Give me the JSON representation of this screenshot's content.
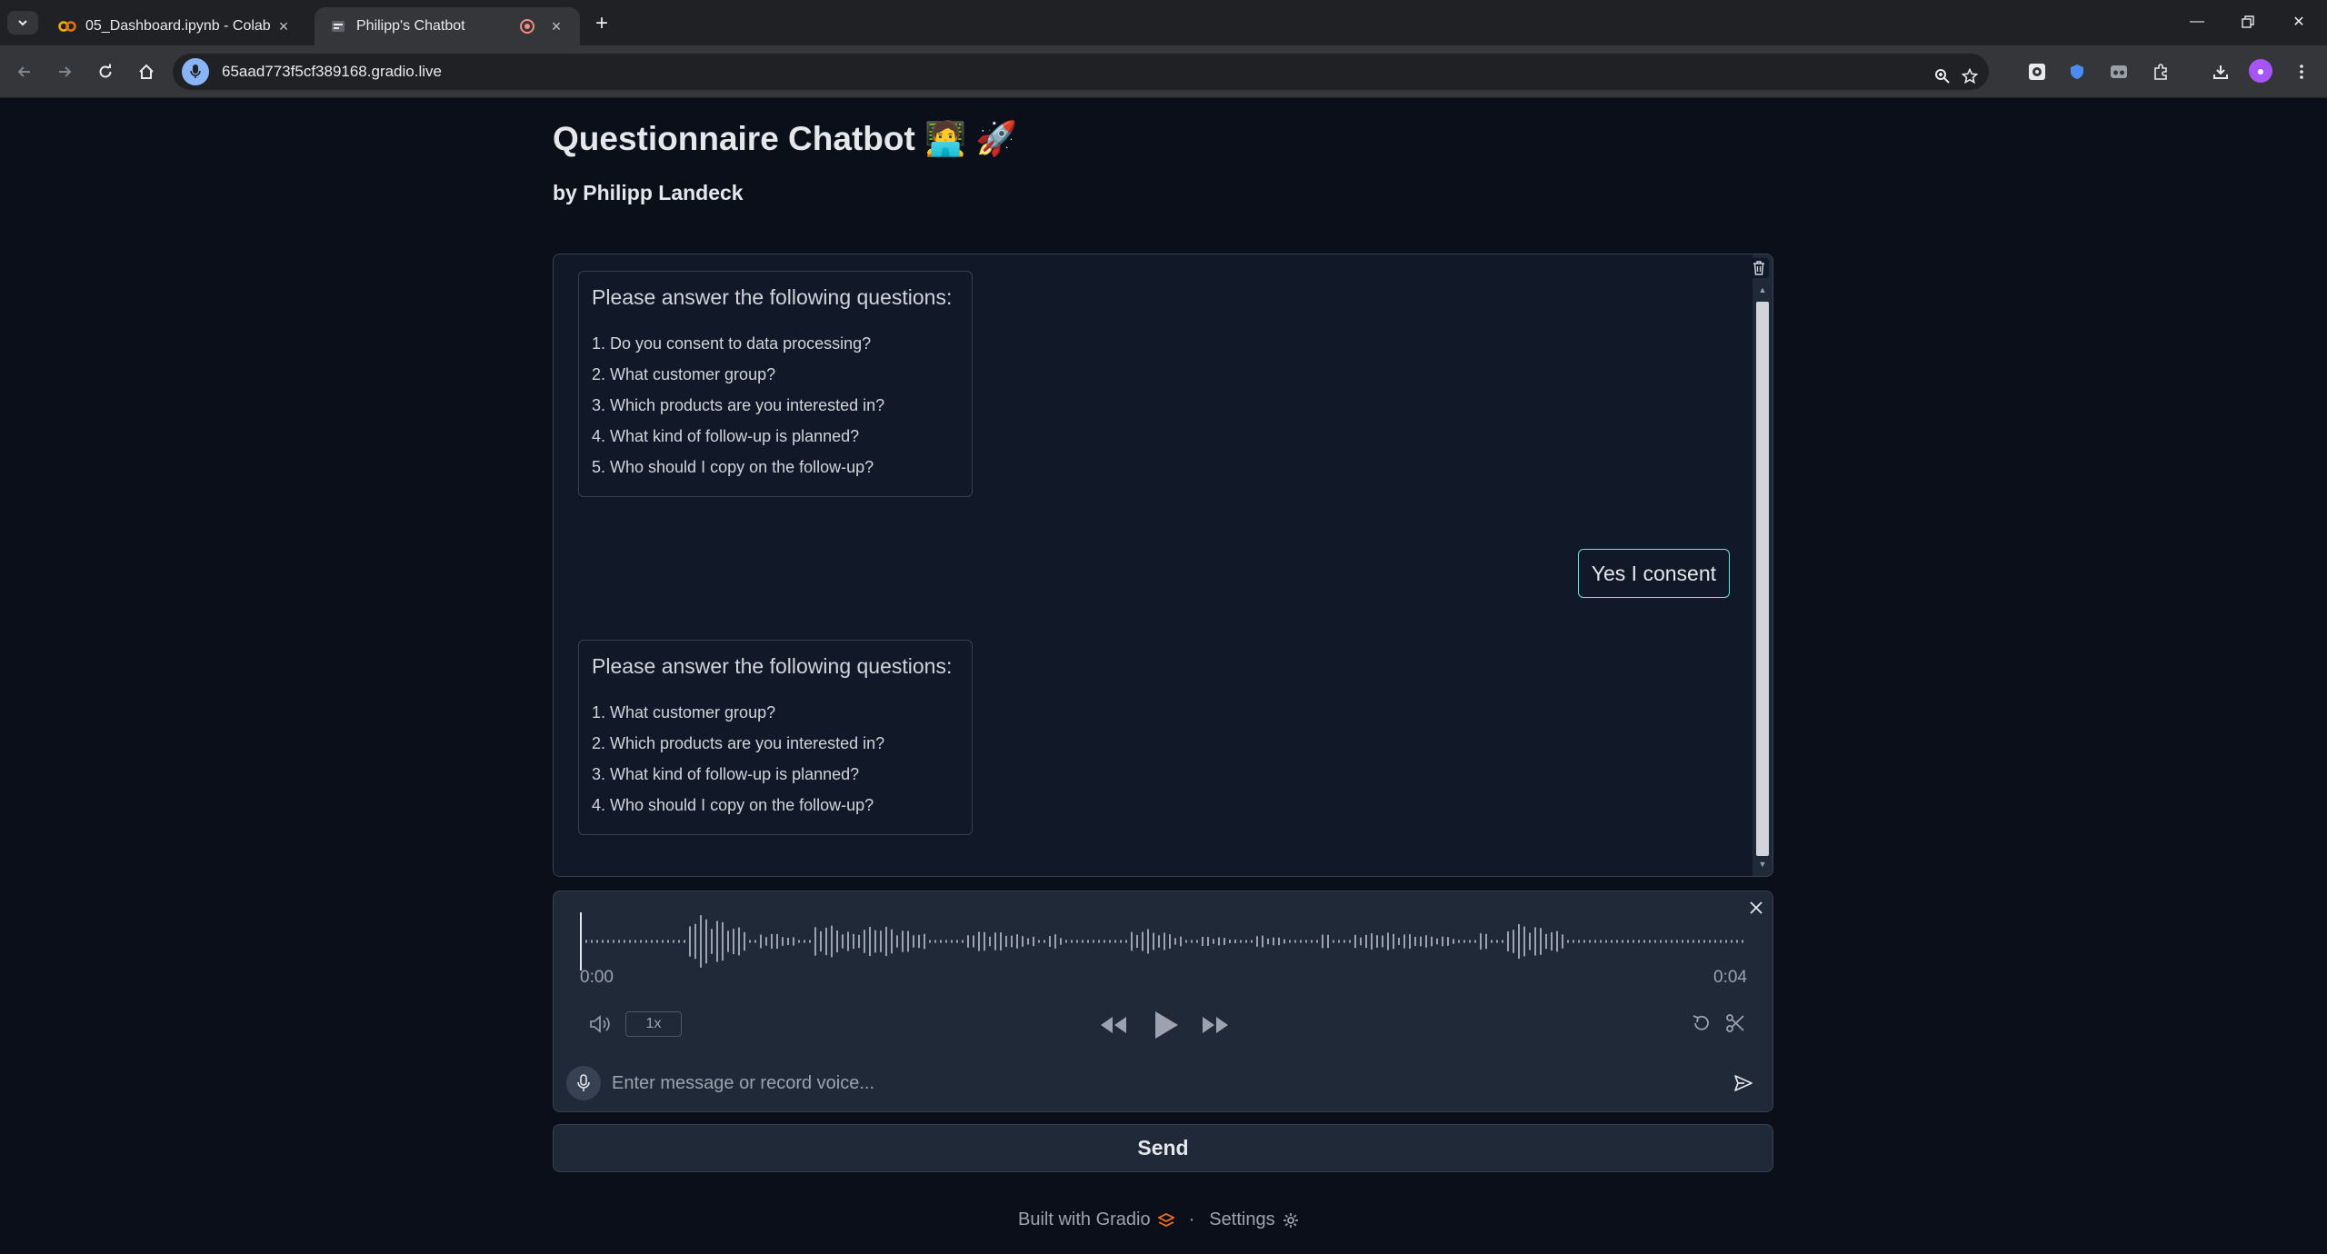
{
  "browser": {
    "tabs": [
      {
        "title": "05_Dashboard.ipynb - Colab",
        "icon": "colab-icon",
        "active": false
      },
      {
        "title": "Philipp's Chatbot",
        "icon": "gradio-icon",
        "active": true
      }
    ],
    "url": "65aad773f5cf389168.gradio.live"
  },
  "app": {
    "title": "Questionnaire Chatbot 🧑‍💻 🚀",
    "subtitle": "by Philipp Landeck"
  },
  "chat": {
    "messages": [
      {
        "role": "bot",
        "title": "Please answer the following questions:",
        "items": [
          "1. Do you consent to data processing?",
          "2. What customer group?",
          "3. Which products are you interested in?",
          "4. What kind of follow-up is planned?",
          "5. Who should I copy on the follow-up?"
        ]
      },
      {
        "role": "user",
        "text": "Yes I consent"
      },
      {
        "role": "bot",
        "title": "Please answer the following questions:",
        "items": [
          "1. What customer group?",
          "2. Which products are you interested in?",
          "3. What kind of follow-up is planned?",
          "4. Who should I copy on the follow-up?"
        ]
      }
    ]
  },
  "audio": {
    "current_time": "0:00",
    "duration": "0:04",
    "speed": "1x",
    "playback_progress": 0
  },
  "input": {
    "placeholder": "Enter message or record voice...",
    "value": ""
  },
  "send_button": "Send",
  "footer": {
    "built_with": "Built with Gradio",
    "separator": "·",
    "settings": "Settings"
  },
  "colors": {
    "page_bg": "#0b0f19",
    "panel_bg": "#1f2937",
    "border": "#374151",
    "accent_user": "#5eead4",
    "gradio_orange": "#f97316"
  }
}
